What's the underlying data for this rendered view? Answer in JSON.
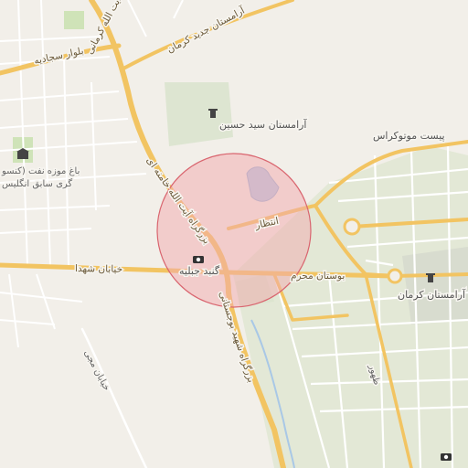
{
  "map": {
    "labels": {
      "road_ayatollah_kermani": "بزرگراه آیت الله کرمانی",
      "road_ayatollah_khamenei": "بزرگراه آیت الله خامنه ای",
      "road_sajjadieh": "بلوار سجادیه",
      "road_shohada": "خیابان شهدا",
      "road_shahid_bojestani": "بزرگراه شهید بوجستانی",
      "road_entezar": "انتظار",
      "road_bustan_moharram": "بوستان محرم",
      "road_motahhari": "خیابان مجی",
      "road_zohur": "ظهور",
      "cemetery_jadid_kerman": "آرامستان جدید کرمان",
      "cemetery_seyed_hossein": "آرامستان سید حسین",
      "post_motocross": "پیست موتوکراس",
      "museum_line1": "باغ موزه نفت (کنسو",
      "museum_line2": "گری سابق انگلیس",
      "gonbad_jabalieh": "گنبد جبلیه",
      "cemetery_kerman": "آرامستان کرمان"
    },
    "icons": [
      "museum-icon",
      "cemetery-icon",
      "camera-icon"
    ],
    "colors": {
      "background": "#f2efe9",
      "road_major": "#f5c96d",
      "road_minor": "#ffffff",
      "park": "#dfe7d3",
      "highlight_circle_fill": "#f2a9ae",
      "highlight_circle_stroke": "#d9656f",
      "water": "#a9c8e6"
    }
  }
}
